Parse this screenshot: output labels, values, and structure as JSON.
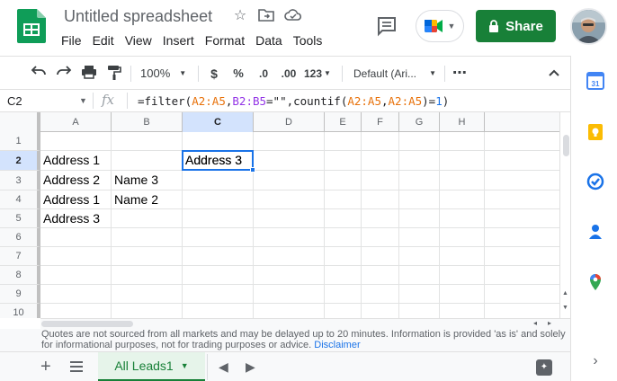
{
  "header": {
    "doc_title": "Untitled spreadsheet",
    "menu": [
      "File",
      "Edit",
      "View",
      "Insert",
      "Format",
      "Data",
      "Tools"
    ],
    "share_label": "Share"
  },
  "toolbar": {
    "zoom": "100%",
    "currency": "$",
    "percent": "%",
    "decrease_decimal": ".0",
    "increase_decimal": ".00",
    "more_formats": "123",
    "font": "Default (Ari...",
    "more": "⋯"
  },
  "formula_bar": {
    "name_box": "C2",
    "fx": "fx",
    "formula_parts": [
      {
        "text": "=filter(",
        "color": "default"
      },
      {
        "text": "A2:A5",
        "color": "orange"
      },
      {
        "text": ",",
        "color": "default"
      },
      {
        "text": "B2:B5",
        "color": "purple"
      },
      {
        "text": "=\"\"",
        "color": "default"
      },
      {
        "text": ",countif(",
        "color": "default"
      },
      {
        "text": "A2:A5",
        "color": "orange"
      },
      {
        "text": ",",
        "color": "default"
      },
      {
        "text": "A2:A5",
        "color": "orange"
      },
      {
        "text": ")=",
        "color": "default"
      },
      {
        "text": "1",
        "color": "blue"
      },
      {
        "text": ")",
        "color": "default"
      }
    ]
  },
  "grid": {
    "columns": [
      "A",
      "B",
      "C",
      "D",
      "E",
      "F",
      "G",
      "H"
    ],
    "rows": [
      "1",
      "2",
      "3",
      "4",
      "5",
      "6",
      "7",
      "8",
      "9",
      "10"
    ],
    "selected_column": "C",
    "selected_row": "2",
    "cells": {
      "A2": "Address 1",
      "C2": "Address 3",
      "A3": "Address 2",
      "B3": "Name 3",
      "A4": "Address 1",
      "B4": "Name 2",
      "A5": "Address 3"
    }
  },
  "disclaimer": {
    "text": "Quotes are not sourced from all markets and may be delayed up to 20 minutes. Information is provided 'as is' and solely for informational purposes, not for trading purposes or advice.",
    "link": "Disclaimer"
  },
  "tabs": {
    "active": "All Leads1"
  },
  "colors": {
    "accent_green": "#188038",
    "selection_blue": "#1a73e8",
    "header_selected": "#d3e3fd"
  }
}
